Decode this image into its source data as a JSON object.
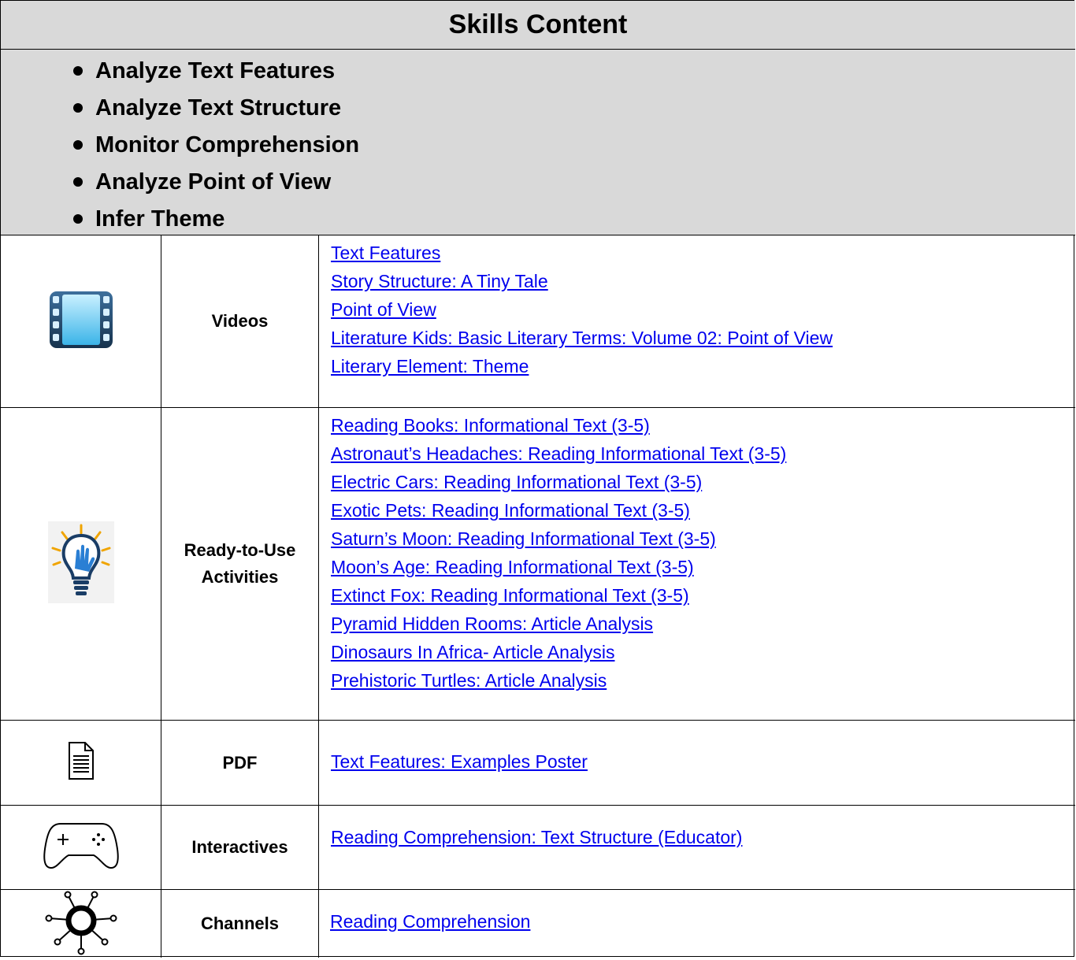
{
  "header": {
    "title": "Skills Content"
  },
  "skills": [
    "Analyze Text Features",
    "Analyze Text Structure",
    "Monitor Comprehension",
    "Analyze Point of View",
    "Infer Theme"
  ],
  "rows": {
    "videos": {
      "icon": "film-strip-icon",
      "label": "Videos",
      "links": [
        "Text Features",
        "Story Structure: A Tiny Tale",
        "Point of View",
        "Literature Kids: Basic Literary Terms: Volume 02: Point of View",
        "Literary Element: Theme"
      ]
    },
    "activities": {
      "icon": "lightbulb-hand-icon",
      "label_line1": "Ready-to-Use",
      "label_line2": "Activities",
      "links": [
        "Reading Books: Informational Text (3-5)",
        "Astronaut’s Headaches: Reading Informational Text (3-5)",
        "Electric Cars: Reading Informational Text (3-5)",
        "Exotic Pets: Reading Informational Text (3-5)",
        "Saturn’s Moon: Reading Informational Text (3-5)",
        "Moon’s Age: Reading Informational Text (3-5)",
        "Extinct Fox: Reading Informational Text (3-5)",
        "Pyramid Hidden Rooms: Article Analysis",
        "Dinosaurs In Africa- Article Analysis",
        "Prehistoric Turtles: Article Analysis"
      ]
    },
    "pdf": {
      "icon": "document-icon",
      "label": "PDF",
      "links": [
        "Text Features: Examples Poster"
      ]
    },
    "interactives": {
      "icon": "gamepad-icon",
      "label": "Interactives",
      "links": [
        "Reading Comprehension: Text Structure (Educator)"
      ]
    },
    "channels": {
      "icon": "network-hub-icon",
      "label": "Channels",
      "links": [
        "Reading Comprehension"
      ]
    }
  },
  "colors": {
    "header_bg": "#d9d9d9",
    "link": "#0000ee",
    "border": "#000000"
  }
}
